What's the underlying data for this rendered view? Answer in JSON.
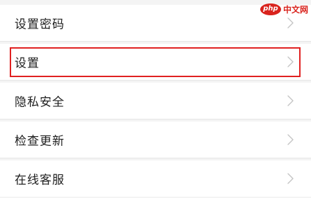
{
  "menu": {
    "items": [
      {
        "label": "设置密码"
      },
      {
        "label": "设置"
      },
      {
        "label": "隐私安全"
      },
      {
        "label": "检查更新"
      },
      {
        "label": "在线客服"
      }
    ]
  },
  "watermark": {
    "logo_text": "php",
    "site_text": "中文网"
  },
  "colors": {
    "highlight": "#e02020",
    "watermark": "#d9231d",
    "chevron": "#c4c4c4"
  }
}
